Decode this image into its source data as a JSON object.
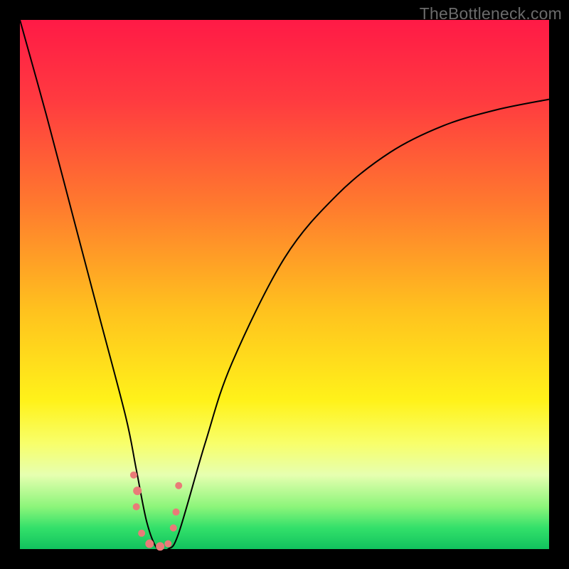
{
  "watermark": "TheBottleneck.com",
  "colors": {
    "frame": "#000000",
    "gradient_top": "#ff1a46",
    "gradient_mid_orange": "#ff7a2e",
    "gradient_mid_yellow": "#fff21a",
    "gradient_bottom": "#11c35e",
    "curve": "#000000",
    "marker": "#e97b78"
  },
  "chart_data": {
    "type": "line",
    "title": "",
    "xlabel": "",
    "ylabel": "",
    "xlim": [
      0,
      100
    ],
    "ylim": [
      0,
      100
    ],
    "series": [
      {
        "name": "bottleneck-curve",
        "x": [
          0,
          5,
          10,
          15,
          20,
          22,
          24,
          26,
          28,
          30,
          35,
          40,
          50,
          60,
          70,
          80,
          90,
          100
        ],
        "y": [
          100,
          82,
          63,
          44,
          25,
          15,
          5,
          0,
          0,
          3,
          20,
          35,
          55,
          67,
          75,
          80,
          83,
          85
        ]
      }
    ],
    "markers": [
      {
        "x": 21.5,
        "y": 14,
        "r": 5
      },
      {
        "x": 22.2,
        "y": 11,
        "r": 6
      },
      {
        "x": 22.0,
        "y": 8,
        "r": 5
      },
      {
        "x": 23.0,
        "y": 3,
        "r": 5
      },
      {
        "x": 24.5,
        "y": 1,
        "r": 6
      },
      {
        "x": 26.5,
        "y": 0.5,
        "r": 6
      },
      {
        "x": 28.0,
        "y": 1,
        "r": 5
      },
      {
        "x": 29.0,
        "y": 4,
        "r": 5
      },
      {
        "x": 29.5,
        "y": 7,
        "r": 5
      },
      {
        "x": 30.0,
        "y": 12,
        "r": 5
      }
    ],
    "annotations": []
  }
}
